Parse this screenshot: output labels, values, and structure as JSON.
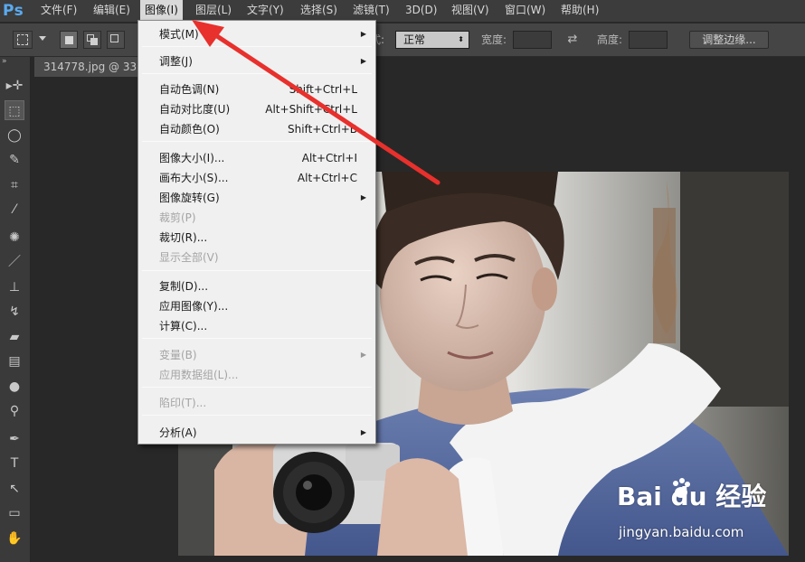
{
  "app": {
    "logo": "Ps",
    "menus": [
      {
        "label": "文件(F)"
      },
      {
        "label": "编辑(E)"
      },
      {
        "label": "图像(I)"
      },
      {
        "label": "图层(L)"
      },
      {
        "label": "文字(Y)"
      },
      {
        "label": "选择(S)"
      },
      {
        "label": "滤镜(T)"
      },
      {
        "label": "3D(D)"
      },
      {
        "label": "视图(V)"
      },
      {
        "label": "窗口(W)"
      },
      {
        "label": "帮助(H)"
      }
    ]
  },
  "options_bar": {
    "style_label": "式:",
    "style_value": "正常",
    "width_label": "宽度:",
    "height_label": "高度:",
    "refine_edge_button": "调整边缘..."
  },
  "document": {
    "tab_title": "314778.jpg @ 33..."
  },
  "image_menu": {
    "items": [
      {
        "label": "模式(M)",
        "shortcut": "",
        "submenu": true,
        "disabled": false
      },
      {
        "label": "调整(J)",
        "shortcut": "",
        "submenu": true,
        "disabled": false
      },
      {
        "label": "自动色调(N)",
        "shortcut": "Shift+Ctrl+L",
        "submenu": false,
        "disabled": false
      },
      {
        "label": "自动对比度(U)",
        "shortcut": "Alt+Shift+Ctrl+L",
        "submenu": false,
        "disabled": false
      },
      {
        "label": "自动颜色(O)",
        "shortcut": "Shift+Ctrl+B",
        "submenu": false,
        "disabled": false
      },
      {
        "label": "图像大小(I)...",
        "shortcut": "Alt+Ctrl+I",
        "submenu": false,
        "disabled": false
      },
      {
        "label": "画布大小(S)...",
        "shortcut": "Alt+Ctrl+C",
        "submenu": false,
        "disabled": false
      },
      {
        "label": "图像旋转(G)",
        "shortcut": "",
        "submenu": true,
        "disabled": false
      },
      {
        "label": "裁剪(P)",
        "shortcut": "",
        "submenu": false,
        "disabled": true
      },
      {
        "label": "裁切(R)...",
        "shortcut": "",
        "submenu": false,
        "disabled": false
      },
      {
        "label": "显示全部(V)",
        "shortcut": "",
        "submenu": false,
        "disabled": true
      },
      {
        "label": "复制(D)...",
        "shortcut": "",
        "submenu": false,
        "disabled": false
      },
      {
        "label": "应用图像(Y)...",
        "shortcut": "",
        "submenu": false,
        "disabled": false
      },
      {
        "label": "计算(C)...",
        "shortcut": "",
        "submenu": false,
        "disabled": false
      },
      {
        "label": "变量(B)",
        "shortcut": "",
        "submenu": true,
        "disabled": true
      },
      {
        "label": "应用数据组(L)...",
        "shortcut": "",
        "submenu": false,
        "disabled": true
      },
      {
        "label": "陷印(T)...",
        "shortcut": "",
        "submenu": false,
        "disabled": true
      },
      {
        "label": "分析(A)",
        "shortcut": "",
        "submenu": true,
        "disabled": false
      }
    ]
  },
  "tools": [
    {
      "icon": "move-tool-icon",
      "glyph": "▸✛"
    },
    {
      "icon": "marquee-tool-icon",
      "glyph": "⬚"
    },
    {
      "icon": "lasso-tool-icon",
      "glyph": "◯"
    },
    {
      "icon": "quick-selection-tool-icon",
      "glyph": "✎"
    },
    {
      "icon": "crop-tool-icon",
      "glyph": "⌗"
    },
    {
      "icon": "eyedropper-tool-icon",
      "glyph": "⁄"
    },
    {
      "icon": "healing-brush-tool-icon",
      "glyph": "✺"
    },
    {
      "icon": "brush-tool-icon",
      "glyph": "／"
    },
    {
      "icon": "clone-stamp-tool-icon",
      "glyph": "⊥"
    },
    {
      "icon": "history-brush-tool-icon",
      "glyph": "↯"
    },
    {
      "icon": "eraser-tool-icon",
      "glyph": "▰"
    },
    {
      "icon": "gradient-tool-icon",
      "glyph": "▤"
    },
    {
      "icon": "blur-tool-icon",
      "glyph": "●"
    },
    {
      "icon": "dodge-tool-icon",
      "glyph": "⚲"
    },
    {
      "icon": "pen-tool-icon",
      "glyph": "✒"
    },
    {
      "icon": "type-tool-icon",
      "glyph": "T"
    },
    {
      "icon": "path-selection-tool-icon",
      "glyph": "↖"
    },
    {
      "icon": "rectangle-tool-icon",
      "glyph": "▭"
    },
    {
      "icon": "hand-tool-icon",
      "glyph": "✋"
    }
  ],
  "watermark": {
    "logo_text": "Bai du 经验",
    "url": "jingyan.baidu.com"
  },
  "colors": {
    "menu_bar_bg": "#3c3c3c",
    "menu_active_bg": "#d9d9d9",
    "dropdown_bg": "#f0f0f0",
    "annotation_arrow": "#e8302c",
    "ps_logo": "#5aaaf0"
  }
}
